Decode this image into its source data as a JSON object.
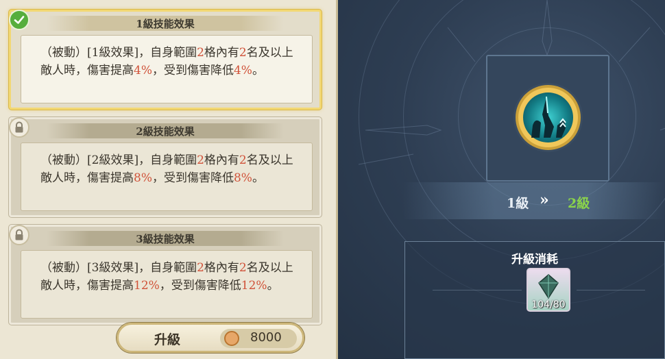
{
  "skill_levels": [
    {
      "title": "1級技能效果",
      "status": "unlocked",
      "desc_parts": [
        "（被動）[1級效果]，自身範圍",
        "2",
        "格內有",
        "2",
        "名及以上敵人時，傷害提高",
        "4%",
        "，受到傷害降低",
        "4%",
        "。"
      ]
    },
    {
      "title": "2級技能效果",
      "status": "locked",
      "desc_parts": [
        "（被動）[2級效果]，自身範圍",
        "2",
        "格內有",
        "2",
        "名及以上敵人時，傷害提高",
        "8%",
        "，受到傷害降低",
        "8%",
        "。"
      ]
    },
    {
      "title": "3級技能效果",
      "status": "locked",
      "desc_parts": [
        "（被動）[3級效果]，自身範圍",
        "2",
        "格內有",
        "2",
        "名及以上敵人時，傷害提高",
        "12%",
        "，受到傷害降低",
        "12%",
        "。"
      ]
    }
  ],
  "level": {
    "current": "1級",
    "next": "2級",
    "arrow": "»"
  },
  "cost": {
    "title": "升級消耗",
    "item_count": "104/80",
    "coin_amount": "8000"
  },
  "upgrade_button": {
    "label": "升級"
  },
  "colors": {
    "highlight": "#d0533a",
    "next_level": "#8bd44b",
    "check": "#56ae3d"
  }
}
